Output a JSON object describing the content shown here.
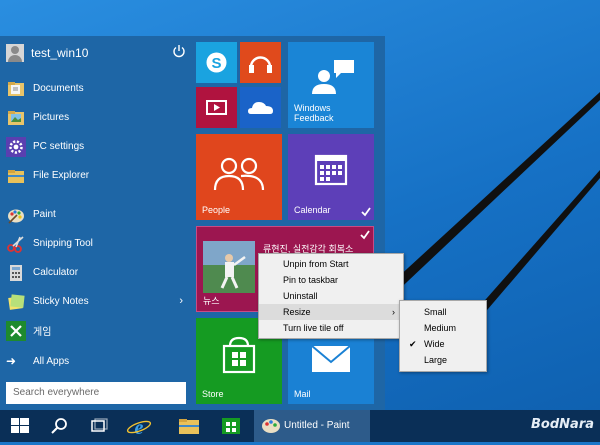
{
  "user": {
    "name": "test_win10"
  },
  "menu": {
    "items": [
      {
        "id": "documents",
        "label": "Documents",
        "icon": "documents-folder-icon"
      },
      {
        "id": "pictures",
        "label": "Pictures",
        "icon": "pictures-folder-icon"
      },
      {
        "id": "pc-settings",
        "label": "PC settings",
        "icon": "gear-icon"
      },
      {
        "id": "file-explorer",
        "label": "File Explorer",
        "icon": "file-explorer-icon"
      },
      {
        "id": "paint",
        "label": "Paint",
        "icon": "paint-palette-icon"
      },
      {
        "id": "snipping-tool",
        "label": "Snipping Tool",
        "icon": "scissors-icon"
      },
      {
        "id": "calculator",
        "label": "Calculator",
        "icon": "calculator-icon"
      },
      {
        "id": "sticky-notes",
        "label": "Sticky Notes",
        "icon": "sticky-notes-icon"
      },
      {
        "id": "games",
        "label": "게임",
        "icon": "xbox-games-icon"
      }
    ],
    "all_apps": "All Apps",
    "search_placeholder": "Search everywhere"
  },
  "tiles": {
    "windows_feedback": "Windows Feedback",
    "people": "People",
    "calendar": "Calendar",
    "news_headline": "류현진, 실전감각 회복소",
    "news_label": "뉴스",
    "store": "Store",
    "mail": "Mail"
  },
  "context_menu": {
    "items": [
      "Unpin from Start",
      "Pin to taskbar",
      "Uninstall",
      "Resize",
      "Turn live tile off"
    ],
    "highlighted": "Resize",
    "resize_options": [
      "Small",
      "Medium",
      "Wide",
      "Large"
    ],
    "resize_checked": "Wide"
  },
  "taskbar": {
    "paint_label": "Untitled - Paint"
  },
  "watermark": "BodNara",
  "colors": {
    "start_bg": "#1e66a6",
    "desktop": "#1a76c9",
    "skype": "#1aa3e0",
    "music": "#e04a1c",
    "feedback": "#1a85d6",
    "video": "#b0133f",
    "onedrive": "#1a63c8",
    "people": "#e0461d",
    "calendar": "#5d3fb8",
    "news": "#9c1650",
    "store": "#159b22",
    "mail": "#1a81d4",
    "taskbar": "#0a2f57"
  }
}
